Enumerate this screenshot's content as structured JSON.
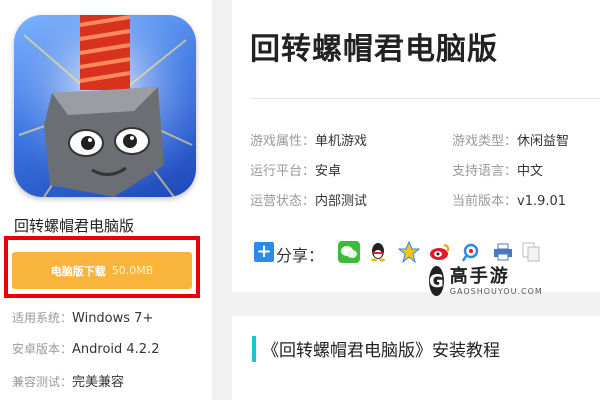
{
  "app": {
    "title": "回转螺帽君电脑版",
    "download_label": "电脑版下载",
    "download_size": "50.0MB"
  },
  "meta": [
    {
      "key": "适用系统：",
      "value": "Windows 7+"
    },
    {
      "key": "安卓版本：",
      "value": "Android 4.2.2"
    },
    {
      "key": "兼容测试：",
      "value": "完美兼容"
    }
  ],
  "header": {
    "title": "回转螺帽君电脑版"
  },
  "info": {
    "attr_key": "游戏属性：",
    "attr_val": "单机游戏",
    "type_key": "游戏类型：",
    "type_val": "休闲益智",
    "platform_key": "运行平台：",
    "platform_val": "安卓",
    "lang_key": "支持语言：",
    "lang_val": "中文",
    "status_key": "运营状态：",
    "status_val": "内部测试",
    "version_key": "当前版本：",
    "version_val": "v1.9.01"
  },
  "share": {
    "label": "分享：",
    "icons": [
      "wechat-icon",
      "qq-icon",
      "qzone-icon",
      "weibo-icon",
      "tencent-weibo-icon",
      "print-icon",
      "copy-icon"
    ]
  },
  "watermark": {
    "name": "高手游",
    "domain": "GAOSHOUYOU.COM",
    "logo": "G"
  },
  "tutorial": {
    "title": "《回转螺帽君电脑版》安装教程"
  },
  "colors": {
    "download_button": "#f9b43b",
    "highlight_border": "#e8000d",
    "accent_bar": "#1fc6c6",
    "share_plus": "#2c8ae8"
  }
}
